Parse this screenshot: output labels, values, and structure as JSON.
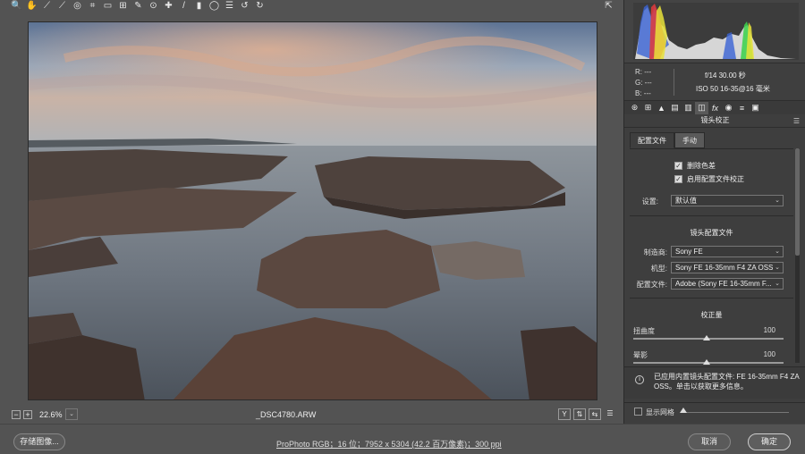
{
  "toolbar": {
    "tools": [
      {
        "name": "zoom-icon",
        "glyph": "🔍"
      },
      {
        "name": "hand-icon",
        "glyph": "✋"
      },
      {
        "name": "white-balance-icon",
        "glyph": "⟋"
      },
      {
        "name": "color-sampler-icon",
        "glyph": "⟋"
      },
      {
        "name": "targeted-adjust-icon",
        "glyph": "◎"
      },
      {
        "name": "crop-icon",
        "glyph": "⌗"
      },
      {
        "name": "straighten-icon",
        "glyph": "▭"
      },
      {
        "name": "transform-icon",
        "glyph": "⊞"
      },
      {
        "name": "spot-removal-icon",
        "glyph": "✎"
      },
      {
        "name": "red-eye-icon",
        "glyph": "⊙"
      },
      {
        "name": "adjustment-brush-icon",
        "glyph": "✚"
      },
      {
        "name": "brush-icon",
        "glyph": "/"
      },
      {
        "name": "graduated-filter-icon",
        "glyph": "▮"
      },
      {
        "name": "radial-filter-icon",
        "glyph": "◯"
      },
      {
        "name": "preferences-icon",
        "glyph": "☰"
      },
      {
        "name": "rotate-left-icon",
        "glyph": "↺"
      },
      {
        "name": "rotate-right-icon",
        "glyph": "↻"
      }
    ],
    "export_icon": "export-icon"
  },
  "status": {
    "zoom_minus": "−",
    "zoom_plus": "+",
    "zoom": "22.6%",
    "zoom_dropdown": "⌄",
    "filename": "_DSC4780.ARW",
    "before_after_y": "Y",
    "icons": [
      "before-after-icon",
      "swap-icon",
      "copy-settings-icon",
      "toggle-settings-icon"
    ]
  },
  "bottom": {
    "save_label": "存储图像...",
    "workflow": "ProPhoto RGB；16 位；7952 x 5304 (42.2 百万像素)；300 ppi",
    "cancel_label": "取消",
    "ok_label": "确定"
  },
  "exif": {
    "r": "R:  ---",
    "g": "G:  ---",
    "b": "B:  ---",
    "line1": "f/14   30.00 秒",
    "line2": "ISO 50    16-35@16 毫米"
  },
  "panel": {
    "title": "镜头校正",
    "tab_profile": "配置文件",
    "tab_manual": "手动",
    "chk_ca": "删除色差",
    "chk_profile": "启用配置文件校正",
    "setting_label": "设置:",
    "setting_value": "默认值",
    "lens_profile_title": "镜头配置文件",
    "make_label": "制造商:",
    "make_value": "Sony FE",
    "model_label": "机型:",
    "model_value": "Sony FE 16-35mm F4 ZA OSS",
    "profile_label": "配置文件:",
    "profile_value": "Adobe (Sony FE 16-35mm F...",
    "correction_title": "校正量",
    "distortion_label": "扭曲度",
    "distortion_value": "100",
    "vignetting_label": "晕影",
    "vignetting_value": "100",
    "info_text": "已应用内置镜头配置文件: FE 16-35mm F4 ZA OSS。单击以获取更多信息。",
    "grid_label": "显示网格"
  },
  "colors": {
    "bg": "#535353",
    "panel": "#3e3e3e"
  }
}
